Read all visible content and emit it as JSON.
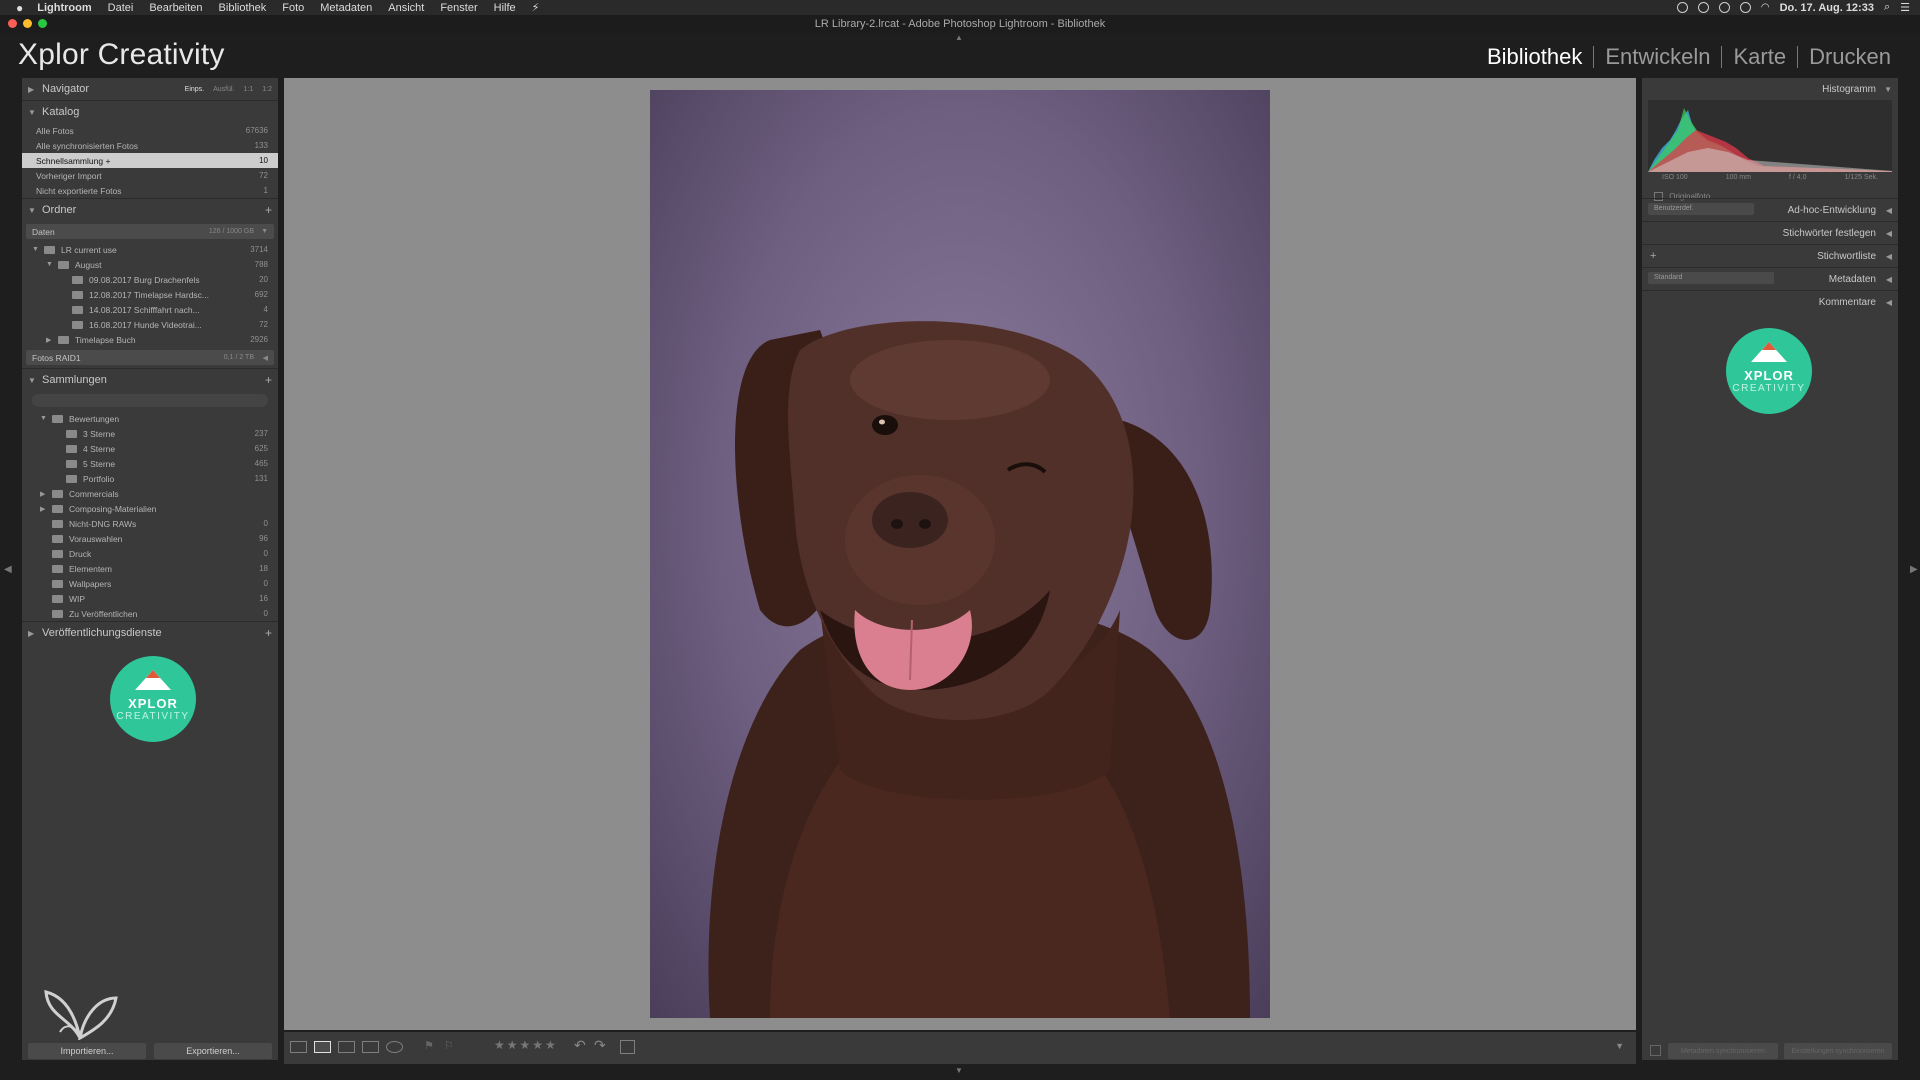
{
  "menubar": {
    "items": [
      "Lightroom",
      "Datei",
      "Bearbeiten",
      "Bibliothek",
      "Foto",
      "Metadaten",
      "Ansicht",
      "Fenster",
      "Hilfe"
    ],
    "clock": "Do. 17. Aug. 12:33"
  },
  "window": {
    "title": "LR Library-2.lrcat - Adobe Photoshop Lightroom - Bibliothek"
  },
  "identity_plate": "Xplor Creativity",
  "modules": [
    "Bibliothek",
    "Entwickeln",
    "Karte",
    "Drucken"
  ],
  "left": {
    "navigator": {
      "title": "Navigator",
      "options": [
        "Einps.",
        "Ausfül.",
        "1:1",
        "1:2"
      ]
    },
    "catalog": {
      "title": "Katalog",
      "items": [
        {
          "label": "Alle Fotos",
          "count": "67636"
        },
        {
          "label": "Alle synchronisierten Fotos",
          "count": "133"
        },
        {
          "label": "Schnellsammlung +",
          "count": "10"
        },
        {
          "label": "Vorheriger Import",
          "count": "72"
        },
        {
          "label": "Nicht exportierte Fotos",
          "count": "1"
        }
      ]
    },
    "folders": {
      "title": "Ordner",
      "volume1": {
        "name": "Daten",
        "info": "126 / 1000 GB"
      },
      "items": [
        {
          "label": "LR current use",
          "count": "3714",
          "level": 1,
          "expanded": "open"
        },
        {
          "label": "August",
          "count": "788",
          "level": 2,
          "expanded": "open"
        },
        {
          "label": "09.08.2017 Burg Drachenfels",
          "count": "20",
          "level": 3,
          "expanded": "none"
        },
        {
          "label": "12.08.2017 Timelapse Hardsc...",
          "count": "692",
          "level": 3,
          "expanded": "none"
        },
        {
          "label": "14.08.2017 Schifffahrt nach...",
          "count": "4",
          "level": 3,
          "expanded": "none"
        },
        {
          "label": "16.08.2017 Hunde Videotrai...",
          "count": "72",
          "level": 3,
          "expanded": "none"
        },
        {
          "label": "Timelapse Buch",
          "count": "2926",
          "level": 2,
          "expanded": "closed"
        }
      ],
      "volume2": {
        "name": "Fotos RAID1",
        "info": "0,1 / 2 TB"
      }
    },
    "collections": {
      "title": "Sammlungen",
      "items": [
        {
          "label": "Bewertungen",
          "count": "",
          "level": 1,
          "expanded": "open"
        },
        {
          "label": "3 Sterne",
          "count": "237",
          "level": 2,
          "expanded": "none"
        },
        {
          "label": "4 Sterne",
          "count": "625",
          "level": 2,
          "expanded": "none"
        },
        {
          "label": "5 Sterne",
          "count": "465",
          "level": 2,
          "expanded": "none"
        },
        {
          "label": "Portfolio",
          "count": "131",
          "level": 2,
          "expanded": "none"
        },
        {
          "label": "Commercials",
          "count": "",
          "level": 1,
          "expanded": "closed"
        },
        {
          "label": "Composing-Materialien",
          "count": "",
          "level": 1,
          "expanded": "closed"
        },
        {
          "label": "Nicht-DNG RAWs",
          "count": "0",
          "level": 1,
          "expanded": "none"
        },
        {
          "label": "Vorauswahlen",
          "count": "96",
          "level": 1,
          "expanded": "none"
        },
        {
          "label": "Druck",
          "count": "0",
          "level": 1,
          "expanded": "none"
        },
        {
          "label": "Elementem",
          "count": "18",
          "level": 1,
          "expanded": "none"
        },
        {
          "label": "Wallpapers",
          "count": "0",
          "level": 1,
          "expanded": "none"
        },
        {
          "label": "WIP",
          "count": "16",
          "level": 1,
          "expanded": "none"
        },
        {
          "label": "Zu Veröffentlichen",
          "count": "0",
          "level": 1,
          "expanded": "none"
        }
      ]
    },
    "publish": {
      "title": "Veröffentlichungsdienste"
    },
    "logo": {
      "line1": "XPLOR",
      "line2": "CREATIVITY"
    },
    "import_label": "Importieren...",
    "export_label": "Exportieren..."
  },
  "right": {
    "histogram": {
      "title": "Histogramm",
      "info": [
        "ISO 100",
        "100 mm",
        "f / 4,0",
        "1/125 Sek."
      ],
      "original_label": "Originalfoto"
    },
    "quick_develop": {
      "title": "Ad-hoc-Entwicklung",
      "preset": "Benutzerdef."
    },
    "keywording": {
      "title": "Stichwörter festlegen"
    },
    "keyword_list": {
      "title": "Stichwortliste"
    },
    "metadata": {
      "title": "Metadaten",
      "preset": "Standard"
    },
    "comments": {
      "title": "Kommentare"
    },
    "logo": {
      "line1": "XPLOR",
      "line2": "CREATIVITY"
    },
    "sync_label": "Metadaten synchronisieren",
    "sync_settings_label": "Einstellungen synchronisieren"
  },
  "toolbar": {
    "rating_stars": "★★★★★"
  },
  "colors": {
    "accent_logo": "#2fc79a",
    "selection": "#cdcdcd",
    "panel": "#3a3a3a",
    "canvas": "#8d8d8d"
  },
  "icons": [
    "apple-icon",
    "grid-view-icon",
    "loupe-view-icon",
    "compare-view-icon",
    "survey-view-icon",
    "people-view-icon",
    "flag-icon",
    "rotate-left-icon",
    "rotate-right-icon",
    "crop-overlay-icon"
  ]
}
